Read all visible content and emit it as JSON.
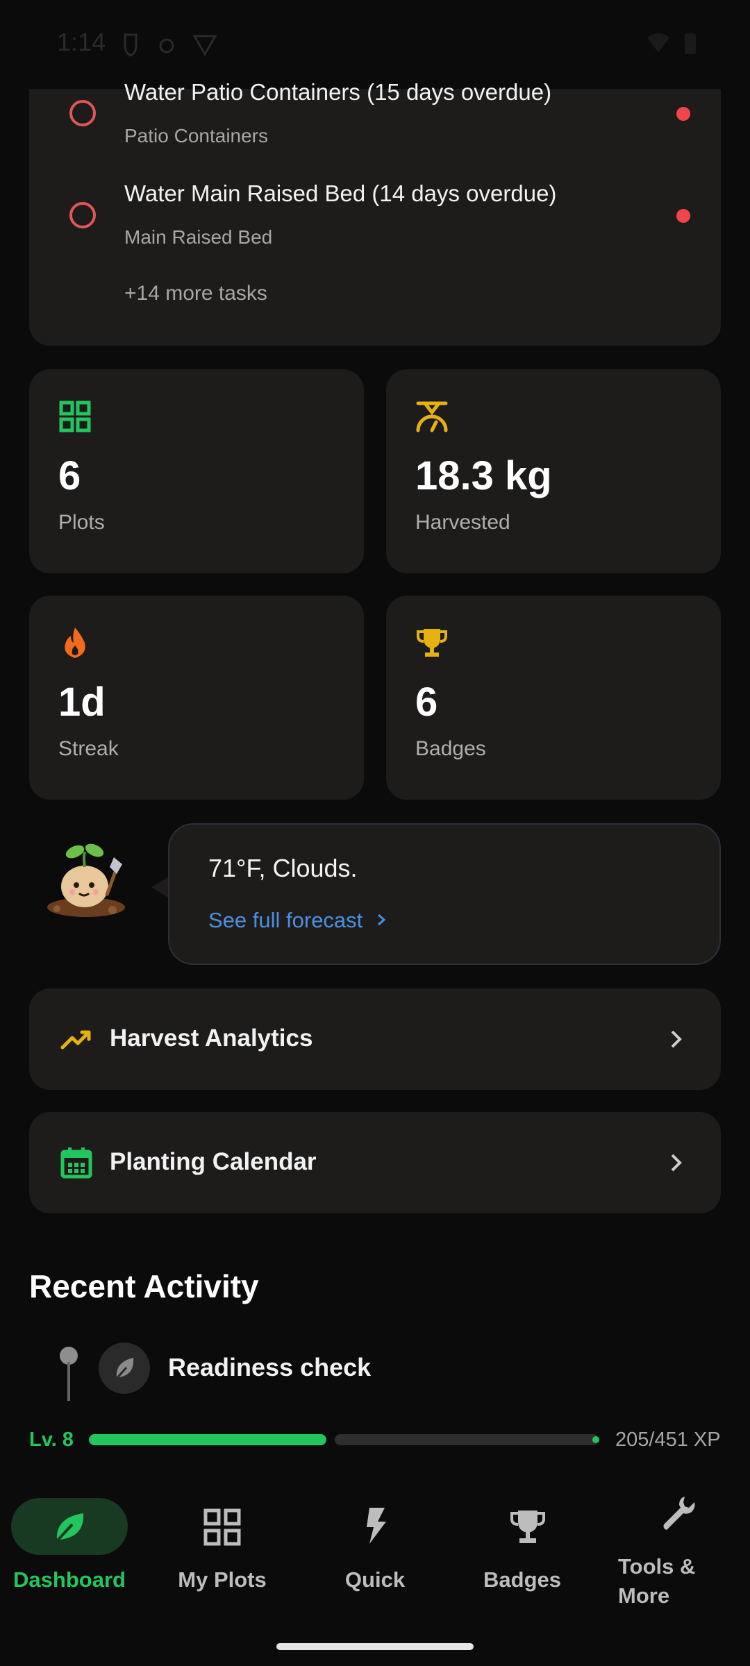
{
  "status_bar": {
    "time": "1:14"
  },
  "tasks": {
    "items": [
      {
        "title": "Water Patio Containers (15 days overdue)",
        "subtitle": "Patio Containers"
      },
      {
        "title": "Water Main Raised Bed (14 days overdue)",
        "subtitle": "Main Raised Bed"
      }
    ],
    "more_label": "+14 more tasks"
  },
  "stats": {
    "plots": {
      "value": "6",
      "label": "Plots",
      "icon": "grid-icon"
    },
    "harvested": {
      "value": "18.3 kg",
      "label": "Harvested",
      "icon": "scale-icon"
    },
    "streak": {
      "value": "1d",
      "label": "Streak",
      "icon": "flame-icon"
    },
    "badges": {
      "value": "6",
      "label": "Badges",
      "icon": "trophy-icon"
    }
  },
  "weather": {
    "text": "71°F, Clouds.",
    "link": "See full forecast"
  },
  "cards": {
    "analytics": {
      "label": "Harvest Analytics",
      "icon": "trending-up-icon"
    },
    "calendar": {
      "label": "Planting Calendar",
      "icon": "calendar-icon"
    }
  },
  "recent": {
    "title": "Recent Activity",
    "items": [
      {
        "label": "Readiness check",
        "icon": "leaf-icon"
      }
    ]
  },
  "xp": {
    "level": "Lv. 8",
    "text": "205/451 XP",
    "current": 205,
    "max": 451
  },
  "bottom_nav": [
    {
      "label": "Dashboard",
      "icon": "leaf-icon",
      "active": true
    },
    {
      "label": "My Plots",
      "icon": "grid-icon",
      "active": false
    },
    {
      "label": "Quick",
      "icon": "bolt-icon",
      "active": false
    },
    {
      "label": "Badges",
      "icon": "trophy-icon",
      "active": false
    },
    {
      "label": "Tools & More",
      "icon": "wrench-icon",
      "active": false
    }
  ],
  "colors": {
    "accent_green": "#22c55e",
    "overdue_red": "#f0464b",
    "gold": "#e5b20f",
    "flame": "#f26b1d",
    "link_blue": "#4a90e2",
    "card_bg": "#1e1c1b"
  }
}
